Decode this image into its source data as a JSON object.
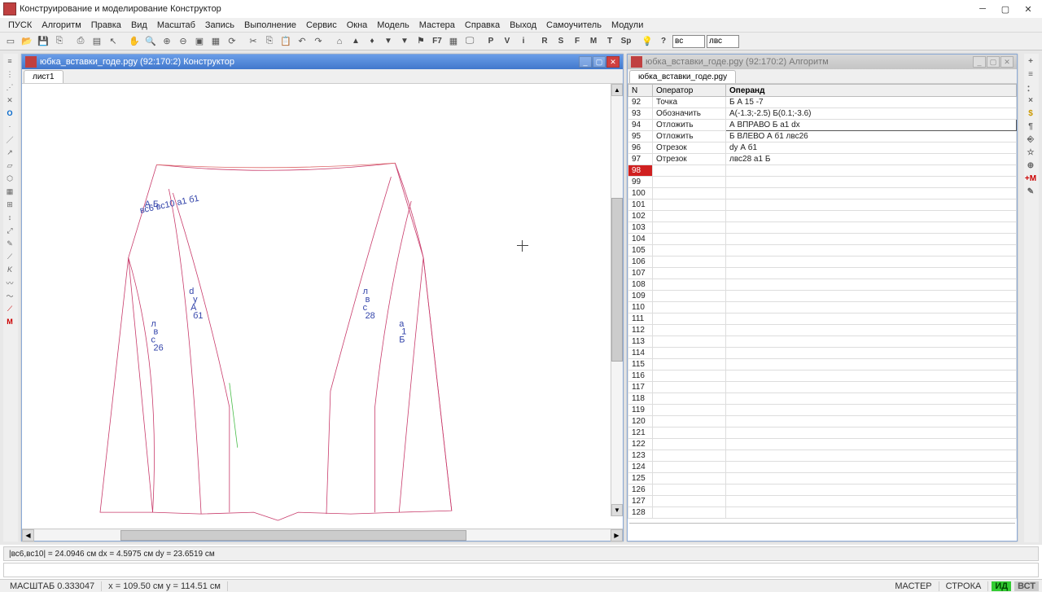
{
  "title": "Конструирование и моделирование Конструктор",
  "menu": [
    "ПУСК",
    "Алгоритм",
    "Правка",
    "Вид",
    "Масштаб",
    "Запись",
    "Выполнение",
    "Сервис",
    "Окна",
    "Модель",
    "Мастера",
    "Справка",
    "Выход",
    "Самоучитель",
    "Модули"
  ],
  "toolbar_letters": [
    "P",
    "V",
    "i",
    "R",
    "S",
    "F",
    "M",
    "T",
    "Sp",
    "?"
  ],
  "toolbar_inputs": {
    "a": "вс",
    "b": "лвс"
  },
  "panel_left": {
    "title": "юбка_вставки_годе.pgy (92:170:2) Конструктор",
    "tab": "лист1"
  },
  "panel_right": {
    "title": "юбка_вставки_годе.pgy (92:170:2) Алгоритм",
    "tab": "юбка_вставки_годе.pgy"
  },
  "grid_headers": {
    "n": "N",
    "op": "Оператор",
    "oper": "Операнд"
  },
  "grid_rows": [
    {
      "n": "92",
      "op": "Точка",
      "oper": "Б А 15 -7"
    },
    {
      "n": "93",
      "op": "Обозначить",
      "oper": "А(-1.3;-2.5) Б(0.1;-3.6)"
    },
    {
      "n": "94",
      "op": "Отложить",
      "oper": "А ВПРАВО Б а1 dx",
      "sel": true
    },
    {
      "n": "95",
      "op": "Отложить",
      "oper": "Б ВЛЕВО А б1 лвс26"
    },
    {
      "n": "96",
      "op": "Отрезок",
      "oper": "dy А б1"
    },
    {
      "n": "97",
      "op": "Отрезок",
      "oper": "лвс28 а1 Б"
    },
    {
      "n": "98",
      "op": "",
      "oper": "",
      "hl": true
    },
    {
      "n": "99",
      "op": "",
      "oper": ""
    },
    {
      "n": "100",
      "op": "",
      "oper": ""
    },
    {
      "n": "101",
      "op": "",
      "oper": ""
    },
    {
      "n": "102",
      "op": "",
      "oper": ""
    },
    {
      "n": "103",
      "op": "",
      "oper": ""
    },
    {
      "n": "104",
      "op": "",
      "oper": ""
    },
    {
      "n": "105",
      "op": "",
      "oper": ""
    },
    {
      "n": "106",
      "op": "",
      "oper": ""
    },
    {
      "n": "107",
      "op": "",
      "oper": ""
    },
    {
      "n": "108",
      "op": "",
      "oper": ""
    },
    {
      "n": "109",
      "op": "",
      "oper": ""
    },
    {
      "n": "110",
      "op": "",
      "oper": ""
    },
    {
      "n": "111",
      "op": "",
      "oper": ""
    },
    {
      "n": "112",
      "op": "",
      "oper": ""
    },
    {
      "n": "113",
      "op": "",
      "oper": ""
    },
    {
      "n": "114",
      "op": "",
      "oper": ""
    },
    {
      "n": "115",
      "op": "",
      "oper": ""
    },
    {
      "n": "116",
      "op": "",
      "oper": ""
    },
    {
      "n": "117",
      "op": "",
      "oper": ""
    },
    {
      "n": "118",
      "op": "",
      "oper": ""
    },
    {
      "n": "119",
      "op": "",
      "oper": ""
    },
    {
      "n": "120",
      "op": "",
      "oper": ""
    },
    {
      "n": "121",
      "op": "",
      "oper": ""
    },
    {
      "n": "122",
      "op": "",
      "oper": ""
    },
    {
      "n": "123",
      "op": "",
      "oper": ""
    },
    {
      "n": "124",
      "op": "",
      "oper": ""
    },
    {
      "n": "125",
      "op": "",
      "oper": ""
    },
    {
      "n": "126",
      "op": "",
      "oper": ""
    },
    {
      "n": "127",
      "op": "",
      "oper": ""
    },
    {
      "n": "128",
      "op": "",
      "oper": ""
    }
  ],
  "info": "|вс6,вс10| = 24.0946 см   dx = 4.5975 см   dy = 23.6519 см",
  "status": {
    "scale": "МАСШТАБ 0.333047",
    "coords": "x = 109.50 см   y = 114.51 см",
    "master": "МАСТЕР",
    "line": "СТРОКА",
    "mode1": "ИД",
    "mode2": "ВСТ"
  }
}
